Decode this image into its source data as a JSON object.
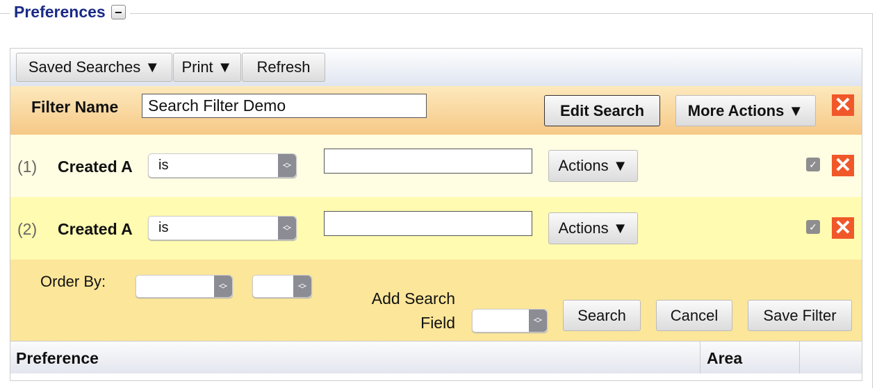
{
  "legend": {
    "title": "Preferences",
    "collapse_symbol": "−"
  },
  "toolbar": {
    "saved_searches": "Saved Searches ▼",
    "print": "Print ▼",
    "refresh": "Refresh"
  },
  "filter": {
    "name_label": "Filter Name",
    "name_value": "Search Filter Demo",
    "edit_search": "Edit Search",
    "more_actions": "More Actions ▼",
    "remove_symbol": "✕"
  },
  "conditions": [
    {
      "index": "(1)",
      "field": "Created A",
      "operator": "is",
      "value": "",
      "actions": "Actions ▼",
      "checked": true
    },
    {
      "index": "(2)",
      "field": "Created A",
      "operator": "is",
      "value": "",
      "actions": "Actions ▼",
      "checked": true
    }
  ],
  "order": {
    "label": "Order By:",
    "field_value": "",
    "direction_value": "",
    "add_field_label_1": "Add Search",
    "add_field_label_2": "Field",
    "add_field_value": "",
    "search": "Search",
    "cancel": "Cancel",
    "save_filter": "Save Filter"
  },
  "table": {
    "columns": [
      "Preference",
      "Area",
      ""
    ]
  },
  "colors": {
    "legend": "#1b2a86",
    "remove": "#f0582a",
    "filter_row": "#f6c886",
    "row1": "#fffde2",
    "row2": "#fffbb0",
    "order": "#fce699"
  }
}
